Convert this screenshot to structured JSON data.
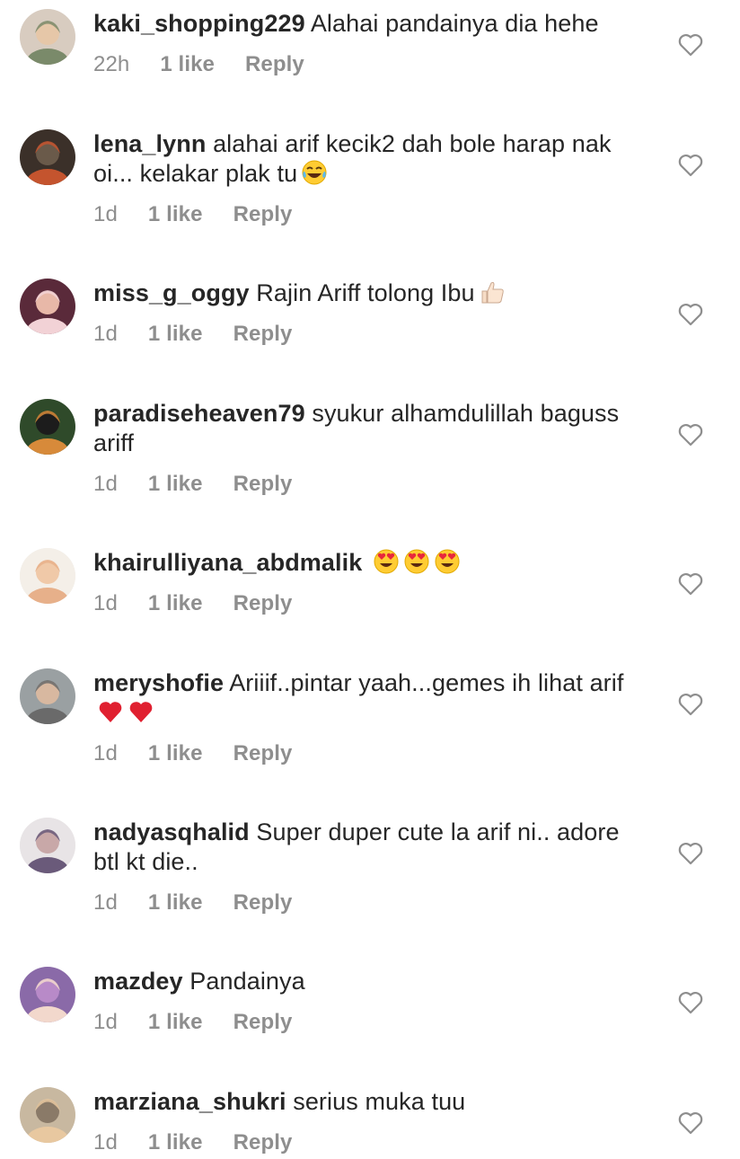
{
  "comments": [
    {
      "username": "kaki_shopping229",
      "text": "Alahai pandainya dia hehe",
      "emojis": [],
      "time": "22h",
      "likes": "1 like",
      "reply": "Reply",
      "avatar_colors": [
        "#d8ccc0",
        "#7a8a6a",
        "#e6c7a8"
      ]
    },
    {
      "username": "lena_lynn",
      "text": "alahai arif kecik2 dah bole harap nak oi... kelakar plak tu",
      "emojis": [
        "laughing-tears"
      ],
      "time": "1d",
      "likes": "1 like",
      "reply": "Reply",
      "avatar_colors": [
        "#3b3029",
        "#c4542e",
        "#6a5a4a"
      ]
    },
    {
      "username": "miss_g_oggy",
      "text": "Rajin Ariff tolong Ibu",
      "emojis": [
        "thumbs-up"
      ],
      "time": "1d",
      "likes": "1 like",
      "reply": "Reply",
      "avatar_colors": [
        "#5a2a3a",
        "#f2d2d6",
        "#e8b8a8"
      ]
    },
    {
      "username": "paradiseheaven79",
      "text": "syukur alhamdulillah baguss ariff",
      "emojis": [],
      "time": "1d",
      "likes": "1 like",
      "reply": "Reply",
      "avatar_colors": [
        "#2f4a2a",
        "#d78a3a",
        "#1c1c1c"
      ]
    },
    {
      "username": "khairulliyana_abdmalik",
      "text": "",
      "emojis": [
        "heart-eyes",
        "heart-eyes",
        "heart-eyes"
      ],
      "time": "1d",
      "likes": "1 like",
      "reply": "Reply",
      "avatar_colors": [
        "#f4efe8",
        "#e7b08a",
        "#f0c9a8"
      ]
    },
    {
      "username": "meryshofie",
      "text": "Ariiif..pintar yaah...gemes ih lihat arif",
      "emojis": [
        "red-heart",
        "red-heart"
      ],
      "time": "1d",
      "likes": "1 like",
      "reply": "Reply",
      "avatar_colors": [
        "#9aa0a2",
        "#6a6a6a",
        "#d8b8a0"
      ]
    },
    {
      "username": "nadyasqhalid",
      "text": "Super duper cute la arif ni.. adore btl kt die..",
      "emojis": [],
      "time": "1d",
      "likes": "1 like",
      "reply": "Reply",
      "avatar_colors": [
        "#e8e4e6",
        "#6a5a7a",
        "#c8a8a8"
      ]
    },
    {
      "username": "mazdey",
      "text": "Pandainya",
      "emojis": [],
      "time": "1d",
      "likes": "1 like",
      "reply": "Reply",
      "avatar_colors": [
        "#8a6aa8",
        "#f2d8cc",
        "#b88ac8"
      ]
    },
    {
      "username": "marziana_shukri",
      "text": "serius muka tuu",
      "emojis": [],
      "time": "1d",
      "likes": "1 like",
      "reply": "Reply",
      "avatar_colors": [
        "#c8b8a0",
        "#e8c8a0",
        "#8a7a68"
      ]
    }
  ],
  "colors": {
    "text": "#262626",
    "secondary": "#8e8e8e",
    "heart_outline": "#8e8e8e"
  }
}
